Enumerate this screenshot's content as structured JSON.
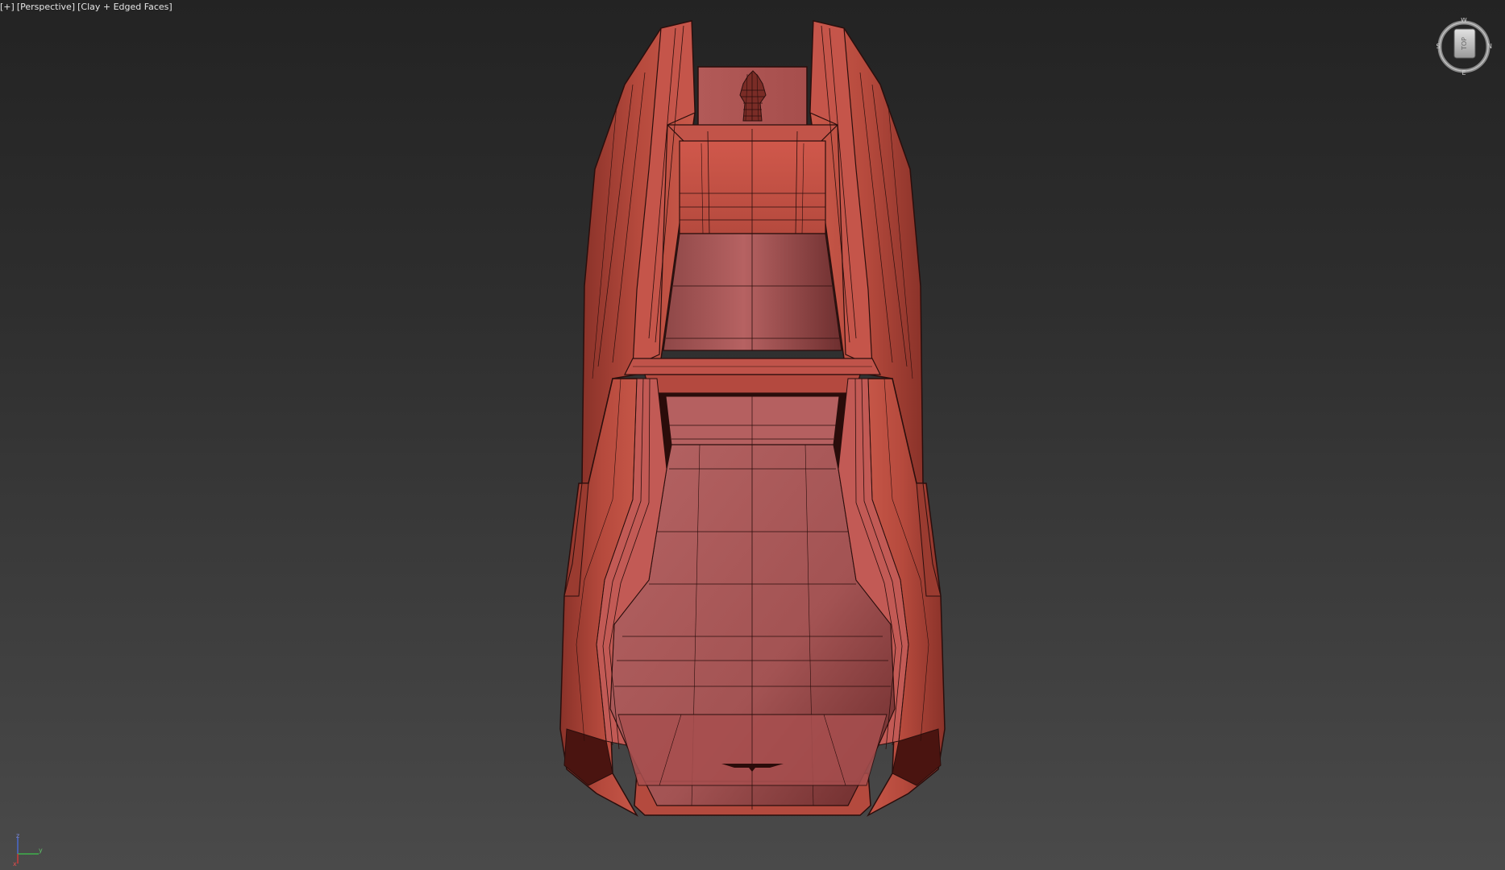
{
  "viewport": {
    "label_plus": "[+]",
    "label_view": "[Perspective]",
    "label_shading": "[Clay + Edged Faces]"
  },
  "viewcube": {
    "face_label": "TOP",
    "compass": {
      "north": "N",
      "south": "S",
      "east": "E",
      "west": "W"
    }
  },
  "axis": {
    "x": "x",
    "y": "y",
    "z": "z"
  },
  "colors": {
    "background_top": "#232323",
    "background_bottom": "#4a4a4a",
    "clay_light": "#c8584a",
    "clay_mid": "#a9463a",
    "clay_dark": "#6e2a24",
    "edge_line": "#2a0e0c",
    "label_text": "#e6e6e6"
  }
}
